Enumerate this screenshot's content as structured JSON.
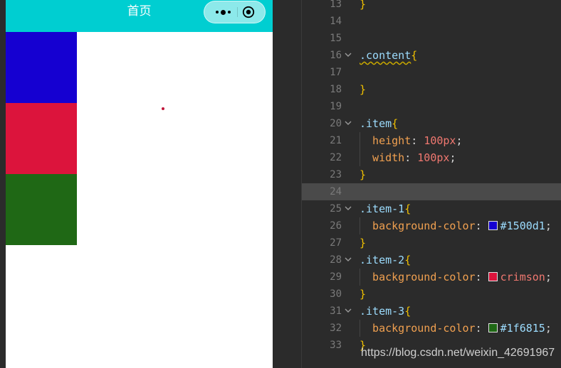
{
  "simulator": {
    "nav_title": "首页",
    "nav_bg_color": "#00ced1",
    "capsule": {
      "more_icon": "more-dots-icon",
      "close_icon": "target-circle-icon"
    },
    "items": [
      {
        "class": "item-1",
        "color": "#1500d1"
      },
      {
        "class": "item-2",
        "color": "crimson"
      },
      {
        "class": "item-3",
        "color": "#1f6815"
      }
    ],
    "dot_color": "#c0163a"
  },
  "editor": {
    "active_line": "24",
    "lines": [
      {
        "num": "13",
        "fold": "",
        "indent": false,
        "tokens": [
          {
            "t": "}",
            "c": "t-brace"
          }
        ]
      },
      {
        "num": "14",
        "fold": "",
        "indent": false,
        "tokens": []
      },
      {
        "num": "15",
        "fold": "",
        "indent": false,
        "tokens": []
      },
      {
        "num": "16",
        "fold": "v",
        "indent": false,
        "tokens": [
          {
            "t": ".content",
            "c": "t-sel squiggle"
          },
          {
            "t": "{",
            "c": "t-brace"
          }
        ]
      },
      {
        "num": "17",
        "fold": "",
        "indent": false,
        "tokens": []
      },
      {
        "num": "18",
        "fold": "",
        "indent": false,
        "tokens": [
          {
            "t": "}",
            "c": "t-brace"
          }
        ]
      },
      {
        "num": "19",
        "fold": "",
        "indent": false,
        "tokens": []
      },
      {
        "num": "20",
        "fold": "v",
        "indent": false,
        "tokens": [
          {
            "t": ".item",
            "c": "t-sel"
          },
          {
            "t": "{",
            "c": "t-brace"
          }
        ]
      },
      {
        "num": "21",
        "fold": "",
        "indent": true,
        "tokens": [
          {
            "t": "  height",
            "c": "t-prop"
          },
          {
            "t": ": ",
            "c": "t-punc"
          },
          {
            "t": "100px",
            "c": "t-num"
          },
          {
            "t": ";",
            "c": "t-punc"
          }
        ]
      },
      {
        "num": "22",
        "fold": "",
        "indent": true,
        "tokens": [
          {
            "t": "  width",
            "c": "t-prop"
          },
          {
            "t": ": ",
            "c": "t-punc"
          },
          {
            "t": "100px",
            "c": "t-num"
          },
          {
            "t": ";",
            "c": "t-punc"
          }
        ]
      },
      {
        "num": "23",
        "fold": "",
        "indent": false,
        "tokens": [
          {
            "t": "}",
            "c": "t-brace"
          }
        ]
      },
      {
        "num": "24",
        "fold": "",
        "indent": false,
        "tokens": []
      },
      {
        "num": "25",
        "fold": "v",
        "indent": false,
        "tokens": [
          {
            "t": ".item-1",
            "c": "t-sel"
          },
          {
            "t": "{",
            "c": "t-brace"
          }
        ]
      },
      {
        "num": "26",
        "fold": "",
        "indent": true,
        "tokens": [
          {
            "t": "  background-color",
            "c": "t-prop"
          },
          {
            "t": ": ",
            "c": "t-punc"
          },
          {
            "t": "",
            "c": "swatch",
            "swatch": "#1500d1"
          },
          {
            "t": "#1500d1",
            "c": "t-hex"
          },
          {
            "t": ";",
            "c": "t-punc"
          }
        ]
      },
      {
        "num": "27",
        "fold": "",
        "indent": false,
        "tokens": [
          {
            "t": "}",
            "c": "t-brace"
          }
        ]
      },
      {
        "num": "28",
        "fold": "v",
        "indent": false,
        "tokens": [
          {
            "t": ".item-2",
            "c": "t-sel"
          },
          {
            "t": "{",
            "c": "t-brace"
          }
        ]
      },
      {
        "num": "29",
        "fold": "",
        "indent": true,
        "tokens": [
          {
            "t": "  background-color",
            "c": "t-prop"
          },
          {
            "t": ": ",
            "c": "t-punc"
          },
          {
            "t": "",
            "c": "swatch",
            "swatch": "crimson"
          },
          {
            "t": "crimson",
            "c": "t-kw"
          },
          {
            "t": ";",
            "c": "t-punc"
          }
        ]
      },
      {
        "num": "30",
        "fold": "",
        "indent": false,
        "tokens": [
          {
            "t": "}",
            "c": "t-brace"
          }
        ]
      },
      {
        "num": "31",
        "fold": "v",
        "indent": false,
        "tokens": [
          {
            "t": ".item-3",
            "c": "t-sel"
          },
          {
            "t": "{",
            "c": "t-brace"
          }
        ]
      },
      {
        "num": "32",
        "fold": "",
        "indent": true,
        "tokens": [
          {
            "t": "  background-color",
            "c": "t-prop"
          },
          {
            "t": ": ",
            "c": "t-punc"
          },
          {
            "t": "",
            "c": "swatch",
            "swatch": "#1f6815"
          },
          {
            "t": "#1f6815",
            "c": "t-hex"
          },
          {
            "t": ";",
            "c": "t-punc"
          }
        ]
      },
      {
        "num": "33",
        "fold": "",
        "indent": false,
        "tokens": [
          {
            "t": "}",
            "c": "t-brace"
          }
        ]
      }
    ]
  },
  "watermark": "https://blog.csdn.net/weixin_42691967"
}
